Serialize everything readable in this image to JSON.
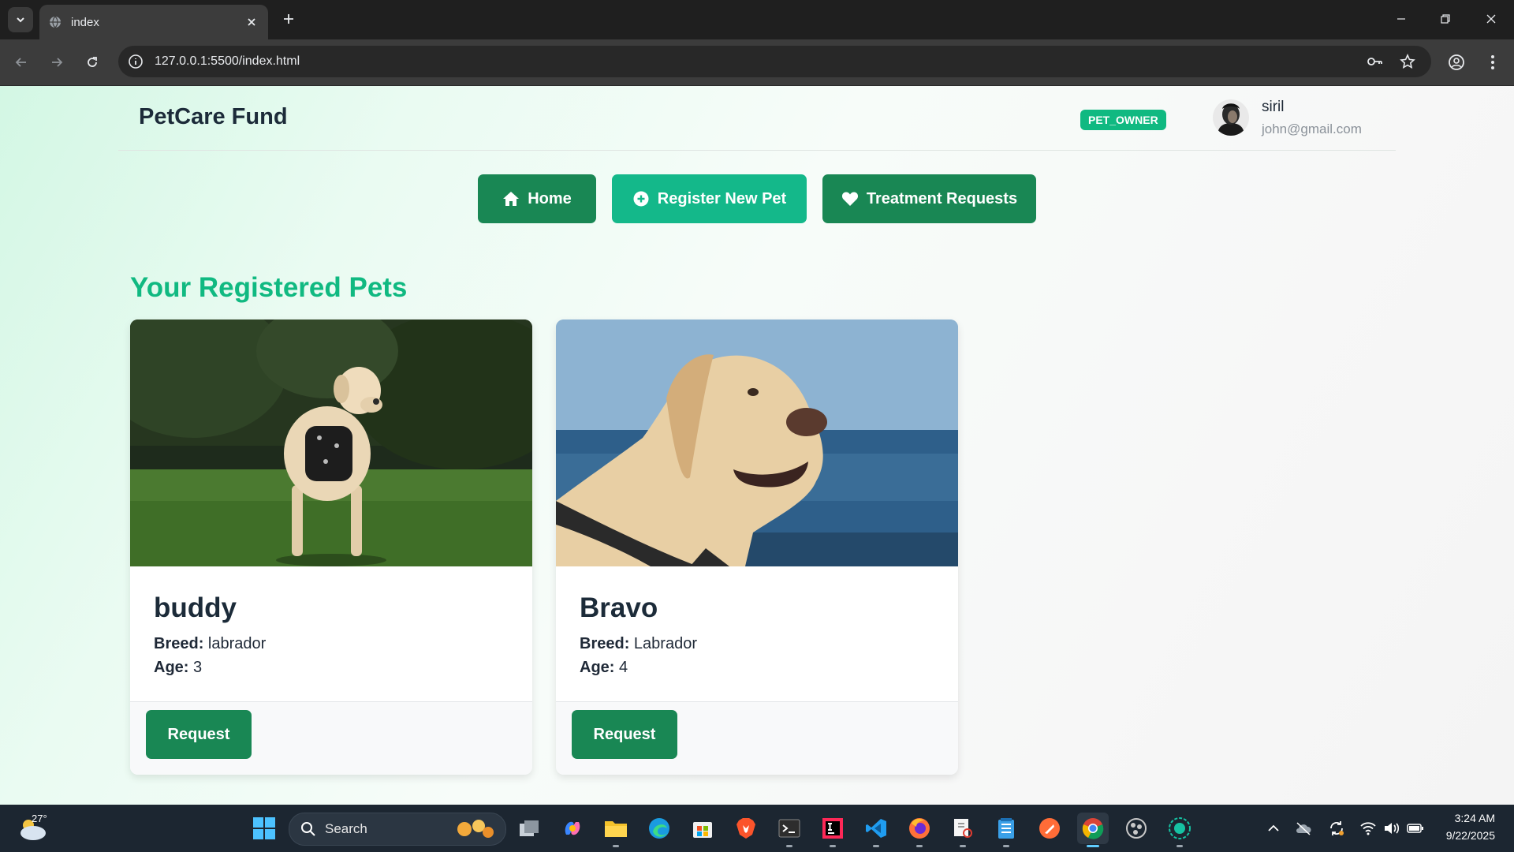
{
  "browser": {
    "tab_title": "index",
    "url": "127.0.0.1:5500/index.html"
  },
  "header": {
    "brand": "PetCare Fund",
    "role_badge": "PET_OWNER",
    "user_name": "siril",
    "user_email": "john@gmail.com"
  },
  "nav": {
    "home": "Home",
    "register": "Register New Pet",
    "treatments": "Treatment Requests"
  },
  "section_title": "Your Registered Pets",
  "pets": [
    {
      "name": "buddy",
      "breed_label": "Breed:",
      "breed": "labrador",
      "age_label": "Age:",
      "age": "3",
      "button": "Request"
    },
    {
      "name": "Bravo",
      "breed_label": "Breed:",
      "breed": "Labrador",
      "age_label": "Age:",
      "age": "4",
      "button": "Request"
    }
  ],
  "taskbar": {
    "weather_temp": "27°",
    "search_placeholder": "Search",
    "time": "3:24 AM",
    "date": "9/22/2025"
  },
  "colors": {
    "brand_green": "#10b981",
    "button_green": "#198754",
    "register_teal": "#14b88a",
    "text_dark": "#1c2b39"
  },
  "icons": [
    "home-icon",
    "plus-circle-icon",
    "heart-icon",
    "key-icon",
    "star-icon",
    "profile-icon",
    "windows-start-icon"
  ]
}
